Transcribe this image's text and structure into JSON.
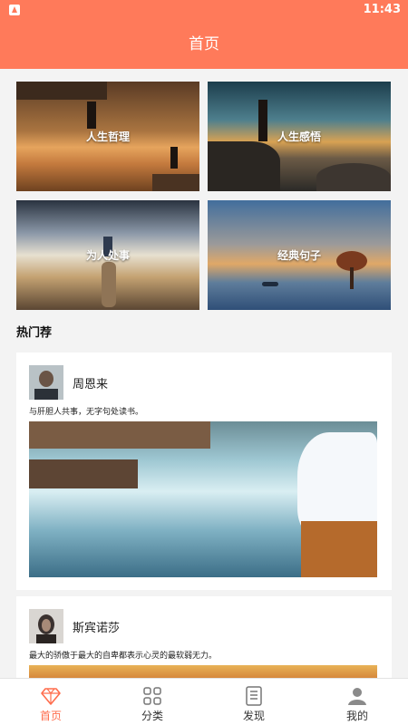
{
  "status_bar": {
    "time": "11:43"
  },
  "header": {
    "title": "首页"
  },
  "categories": [
    {
      "label": "人生哲理"
    },
    {
      "label": "人生感悟"
    },
    {
      "label": "为人处事"
    },
    {
      "label": "经典句子"
    }
  ],
  "section": {
    "title": "热门荐"
  },
  "posts": [
    {
      "author": "周恩来",
      "quote": "与肝胆人共事，无字句处读书。"
    },
    {
      "author": "斯宾诺莎",
      "quote": "最大的骄傲于最大的自卑都表示心灵的最软弱无力。"
    }
  ],
  "nav": {
    "items": [
      {
        "label": "首页",
        "icon": "diamond-icon",
        "active": true
      },
      {
        "label": "分类",
        "icon": "grid-icon",
        "active": false
      },
      {
        "label": "发现",
        "icon": "list-icon",
        "active": false
      },
      {
        "label": "我的",
        "icon": "user-icon",
        "active": false
      }
    ]
  },
  "colors": {
    "accent": "#ff7a5a",
    "active_nav": "#ff6d4d"
  }
}
